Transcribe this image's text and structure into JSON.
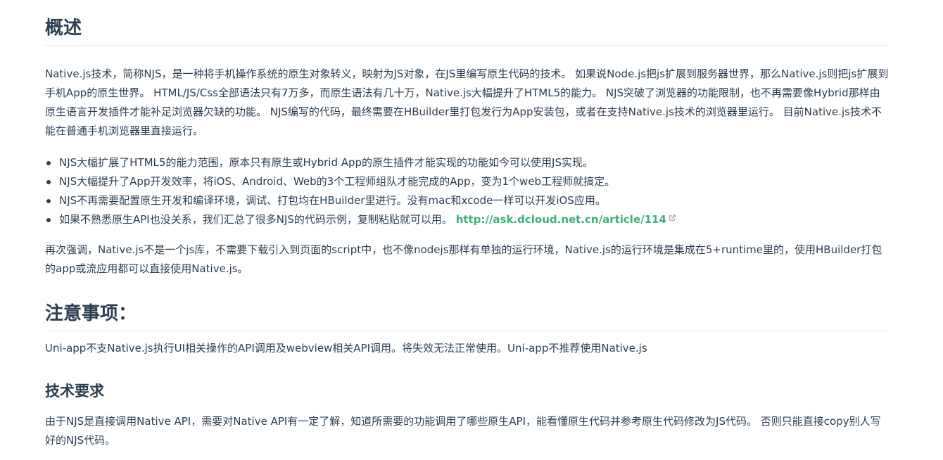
{
  "overview": {
    "title": "概述",
    "intro": "Native.js技术，简称NJS，是一种将手机操作系统的原生对象转义，映射为JS对象，在JS里编写原生代码的技术。 如果说Node.js把js扩展到服务器世界，那么Native.js则把js扩展到手机App的原生世界。 HTML/JS/Css全部语法只有7万多，而原生语法有几十万，Native.js大幅提升了HTML5的能力。 NJS突破了浏览器的功能限制，也不再需要像Hybrid那样由原生语言开发插件才能补足浏览器欠缺的功能。 NJS编写的代码，最终需要在HBuilder里打包发行为App安装包，或者在支持Native.js技术的浏览器里运行。 目前Native.js技术不能在普通手机浏览器里直接运行。",
    "bullets": [
      "NJS大幅扩展了HTML5的能力范围，原本只有原生或Hybrid App的原生插件才能实现的功能如今可以使用JS实现。",
      "NJS大幅提升了App开发效率，将iOS、Android、Web的3个工程师组队才能完成的App，变为1个web工程师就搞定。",
      "NJS不再需要配置原生开发和编译环境，调试、打包均在HBuilder里进行。没有mac和xcode一样可以开发iOS应用。",
      "如果不熟悉原生API也没关系，我们汇总了很多NJS的代码示例，复制粘贴就可以用。"
    ],
    "link_text": "http://ask.dcloud.net.cn/article/114",
    "outro": "再次强调，Native.js不是一个js库，不需要下载引入到页面的script中，也不像nodejs那样有单独的运行环境，Native.js的运行环境是集成在5+runtime里的，使用HBuilder打包的app或流应用都可以直接使用Native.js。"
  },
  "notes": {
    "title": "注意事项：",
    "body": "Uni-app不支Native.js执行UI相关操作的API调用及webview相关API调用。将失效无法正常使用。Uni-app不推荐使用Native.js"
  },
  "requirements": {
    "title": "技术要求",
    "body": "由于NJS是直接调用Native API，需要对Native API有一定了解，知道所需要的功能调用了哪些原生API，能看懂原生代码并参考原生代码修改为JS代码。 否则只能直接copy别人写好的NJS代码。"
  },
  "colors": {
    "text": "#2c3e50",
    "link": "#3eaf7c",
    "divider": "#eaecef"
  },
  "icons": {
    "external_link": "external-link-icon"
  }
}
